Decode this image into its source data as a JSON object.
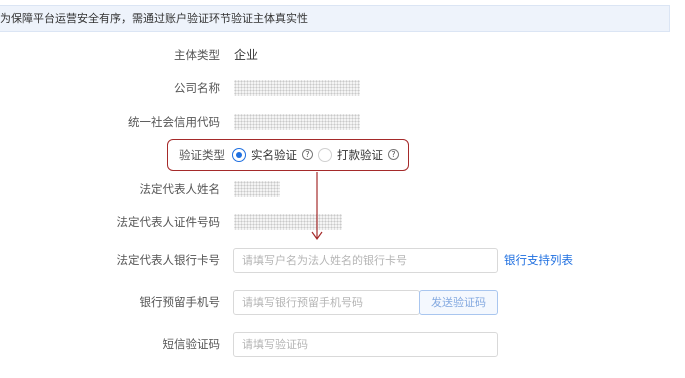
{
  "notice": {
    "text": "为保障平台运营安全有序，需通过账户验证环节验证主体真实性"
  },
  "form": {
    "subject_type": {
      "label": "主体类型",
      "value": "企业"
    },
    "company_name": {
      "label": "公司名称"
    },
    "credit_code": {
      "label": "统一社会信用代码"
    },
    "verify_type": {
      "label": "验证类型",
      "options": [
        {
          "label": "实名验证",
          "checked": true
        },
        {
          "label": "打款验证",
          "checked": false
        }
      ],
      "help_glyph": "?"
    },
    "legal_name": {
      "label": "法定代表人姓名"
    },
    "legal_id": {
      "label": "法定代表人证件号码"
    },
    "bank_card": {
      "label": "法定代表人银行卡号",
      "placeholder": "请填写户名为法人姓名的银行卡号",
      "link": "银行支持列表"
    },
    "phone": {
      "label": "银行预留手机号",
      "placeholder": "请填写银行预留手机号码",
      "send_button": "发送验证码"
    },
    "sms_code": {
      "label": "短信验证码",
      "placeholder": "请填写验证码"
    }
  },
  "colors": {
    "accent": "#1f6fe0",
    "annotation": "#a52a2a",
    "notice_bg": "#eef3fb"
  }
}
